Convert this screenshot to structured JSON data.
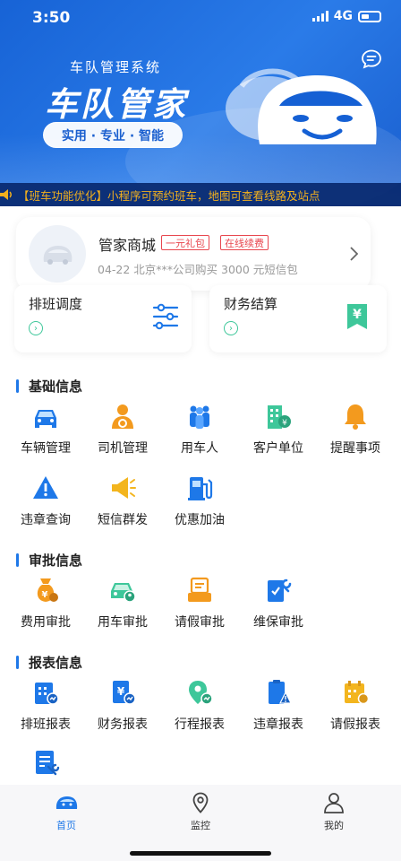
{
  "status": {
    "time": "3:50",
    "network": "4G"
  },
  "hero": {
    "subtitle": "车队管理系统",
    "title": "车队管家",
    "tagline": "实用 · 专业 · 智能"
  },
  "notice": {
    "text": "【班车功能优化】小程序可预约班车，地图可查看线路及站点"
  },
  "shop": {
    "title": "管家商城",
    "badges": [
      "一元礼包",
      "在线续费"
    ],
    "desc": "04-22 北京***公司购买 3000 元短信包"
  },
  "quick": [
    {
      "label": "排班调度"
    },
    {
      "label": "财务结算"
    }
  ],
  "sections": {
    "basic": {
      "title": "基础信息",
      "items": [
        {
          "label": "车辆管理",
          "icon": "car-icon"
        },
        {
          "label": "司机管理",
          "icon": "driver-icon"
        },
        {
          "label": "用车人",
          "icon": "users-icon"
        },
        {
          "label": "客户单位",
          "icon": "building-icon"
        },
        {
          "label": "提醒事项",
          "icon": "bell-icon"
        },
        {
          "label": "违章查询",
          "icon": "warning-icon"
        },
        {
          "label": "短信群发",
          "icon": "megaphone-icon"
        },
        {
          "label": "优惠加油",
          "icon": "fuel-icon"
        }
      ]
    },
    "approval": {
      "title": "审批信息",
      "items": [
        {
          "label": "费用审批",
          "icon": "money-bag-icon"
        },
        {
          "label": "用车审批",
          "icon": "car-approval-icon"
        },
        {
          "label": "请假审批",
          "icon": "leave-icon"
        },
        {
          "label": "维保审批",
          "icon": "maintenance-icon"
        }
      ]
    },
    "reports": {
      "title": "报表信息",
      "items": [
        {
          "label": "排班报表",
          "icon": "schedule-report-icon"
        },
        {
          "label": "财务报表",
          "icon": "finance-report-icon"
        },
        {
          "label": "行程报表",
          "icon": "trip-report-icon"
        },
        {
          "label": "违章报表",
          "icon": "violation-report-icon"
        },
        {
          "label": "请假报表",
          "icon": "leave-report-icon"
        },
        {
          "label": "",
          "icon": "maintenance-report-icon"
        }
      ]
    }
  },
  "tabs": [
    {
      "label": "首页",
      "active": true
    },
    {
      "label": "监控",
      "active": false
    },
    {
      "label": "我的",
      "active": false
    }
  ],
  "colors": {
    "brand": "#1e78e8",
    "accent_green": "#3ec79a",
    "orange": "#f39a1e",
    "badge_red": "#e8464e",
    "notice_text": "#f2b01e"
  }
}
